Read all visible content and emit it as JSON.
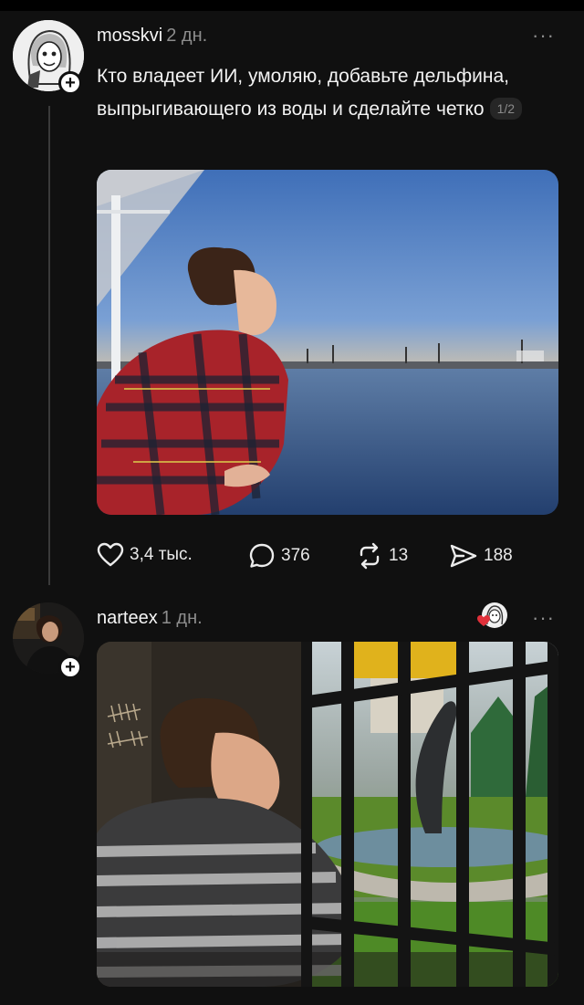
{
  "post1": {
    "username": "mosskvi",
    "time": "2 дн.",
    "more": "···",
    "text": "Кто владеет ИИ, умоляю, добавьте дельфина, выпрыгивающего из воды и сделайте четко",
    "pager": "1/2",
    "actions": {
      "likes": "3,4 тыс.",
      "comments": "376",
      "reposts": "13",
      "shares": "188"
    }
  },
  "post2": {
    "username": "narteex",
    "time": "1 дн.",
    "more": "···"
  },
  "colors": {
    "background": "#101010",
    "muted": "#8d8d8d",
    "reaction_heart": "#e0303a"
  },
  "icons": [
    "plus-icon",
    "heart-icon",
    "comment-icon",
    "repost-icon",
    "share-icon",
    "more-icon"
  ]
}
